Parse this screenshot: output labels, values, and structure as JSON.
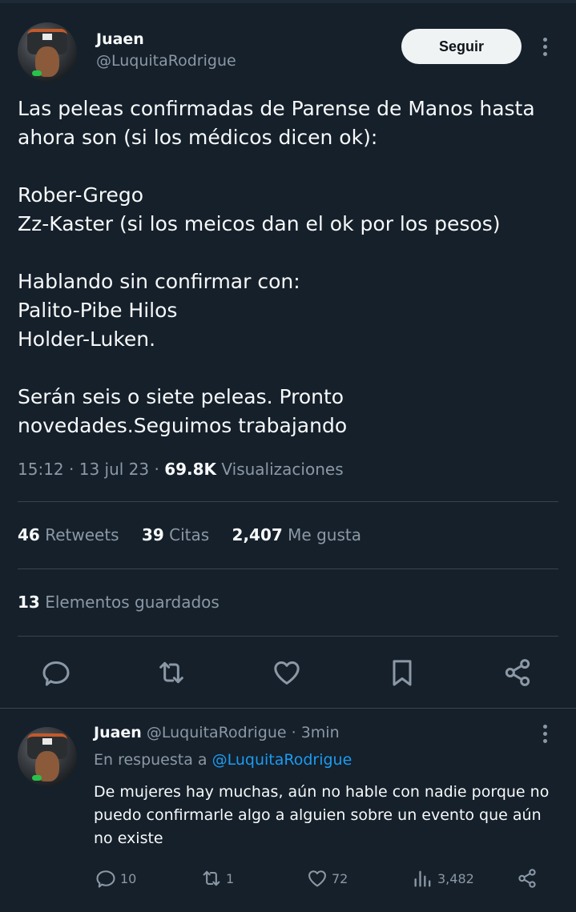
{
  "main_tweet": {
    "author_name": "Juaen",
    "author_handle": "@LuquitaRodrigue",
    "follow_label": "Seguir",
    "text_lines": [
      "Las peleas confirmadas de Parense de Manos hasta",
      "ahora son (si los médicos dicen ok):",
      "",
      "Rober-Grego",
      "Zz-Kaster (si los meicos dan el ok por los pesos)",
      "",
      "Hablando sin confirmar con:",
      "Palito-Pibe Hilos",
      "Holder-Luken.",
      "",
      "Serán seis o siete peleas. Pronto",
      "novedades.Seguimos trabajando"
    ],
    "time": "15:12",
    "date": "13 jul 23",
    "views_count": "69.8K",
    "views_label": "Visualizaciones",
    "retweets_count": "46",
    "retweets_label": "Retweets",
    "quotes_count": "39",
    "quotes_label": "Citas",
    "likes_count": "2,407",
    "likes_label": "Me gusta",
    "bookmarks_count": "13",
    "bookmarks_label": "Elementos guardados"
  },
  "reply": {
    "author_name": "Juaen",
    "author_handle": "@LuquitaRodrigue",
    "time_ago": "3min",
    "replying_to_prefix": "En respuesta a",
    "replying_to_handle": "@LuquitaRodrigue",
    "text": "De mujeres hay muchas, aún no hable con nadie porque no puedo confirmarle algo a alguien sobre un evento que aún no existe",
    "reply_count": "10",
    "retweet_count": "1",
    "like_count": "72",
    "views_count": "3,482"
  },
  "colors": {
    "background": "#15202b",
    "text": "#f7f9f9",
    "muted": "#8b98a5",
    "link": "#1d9bf0",
    "divider": "#38444d"
  }
}
